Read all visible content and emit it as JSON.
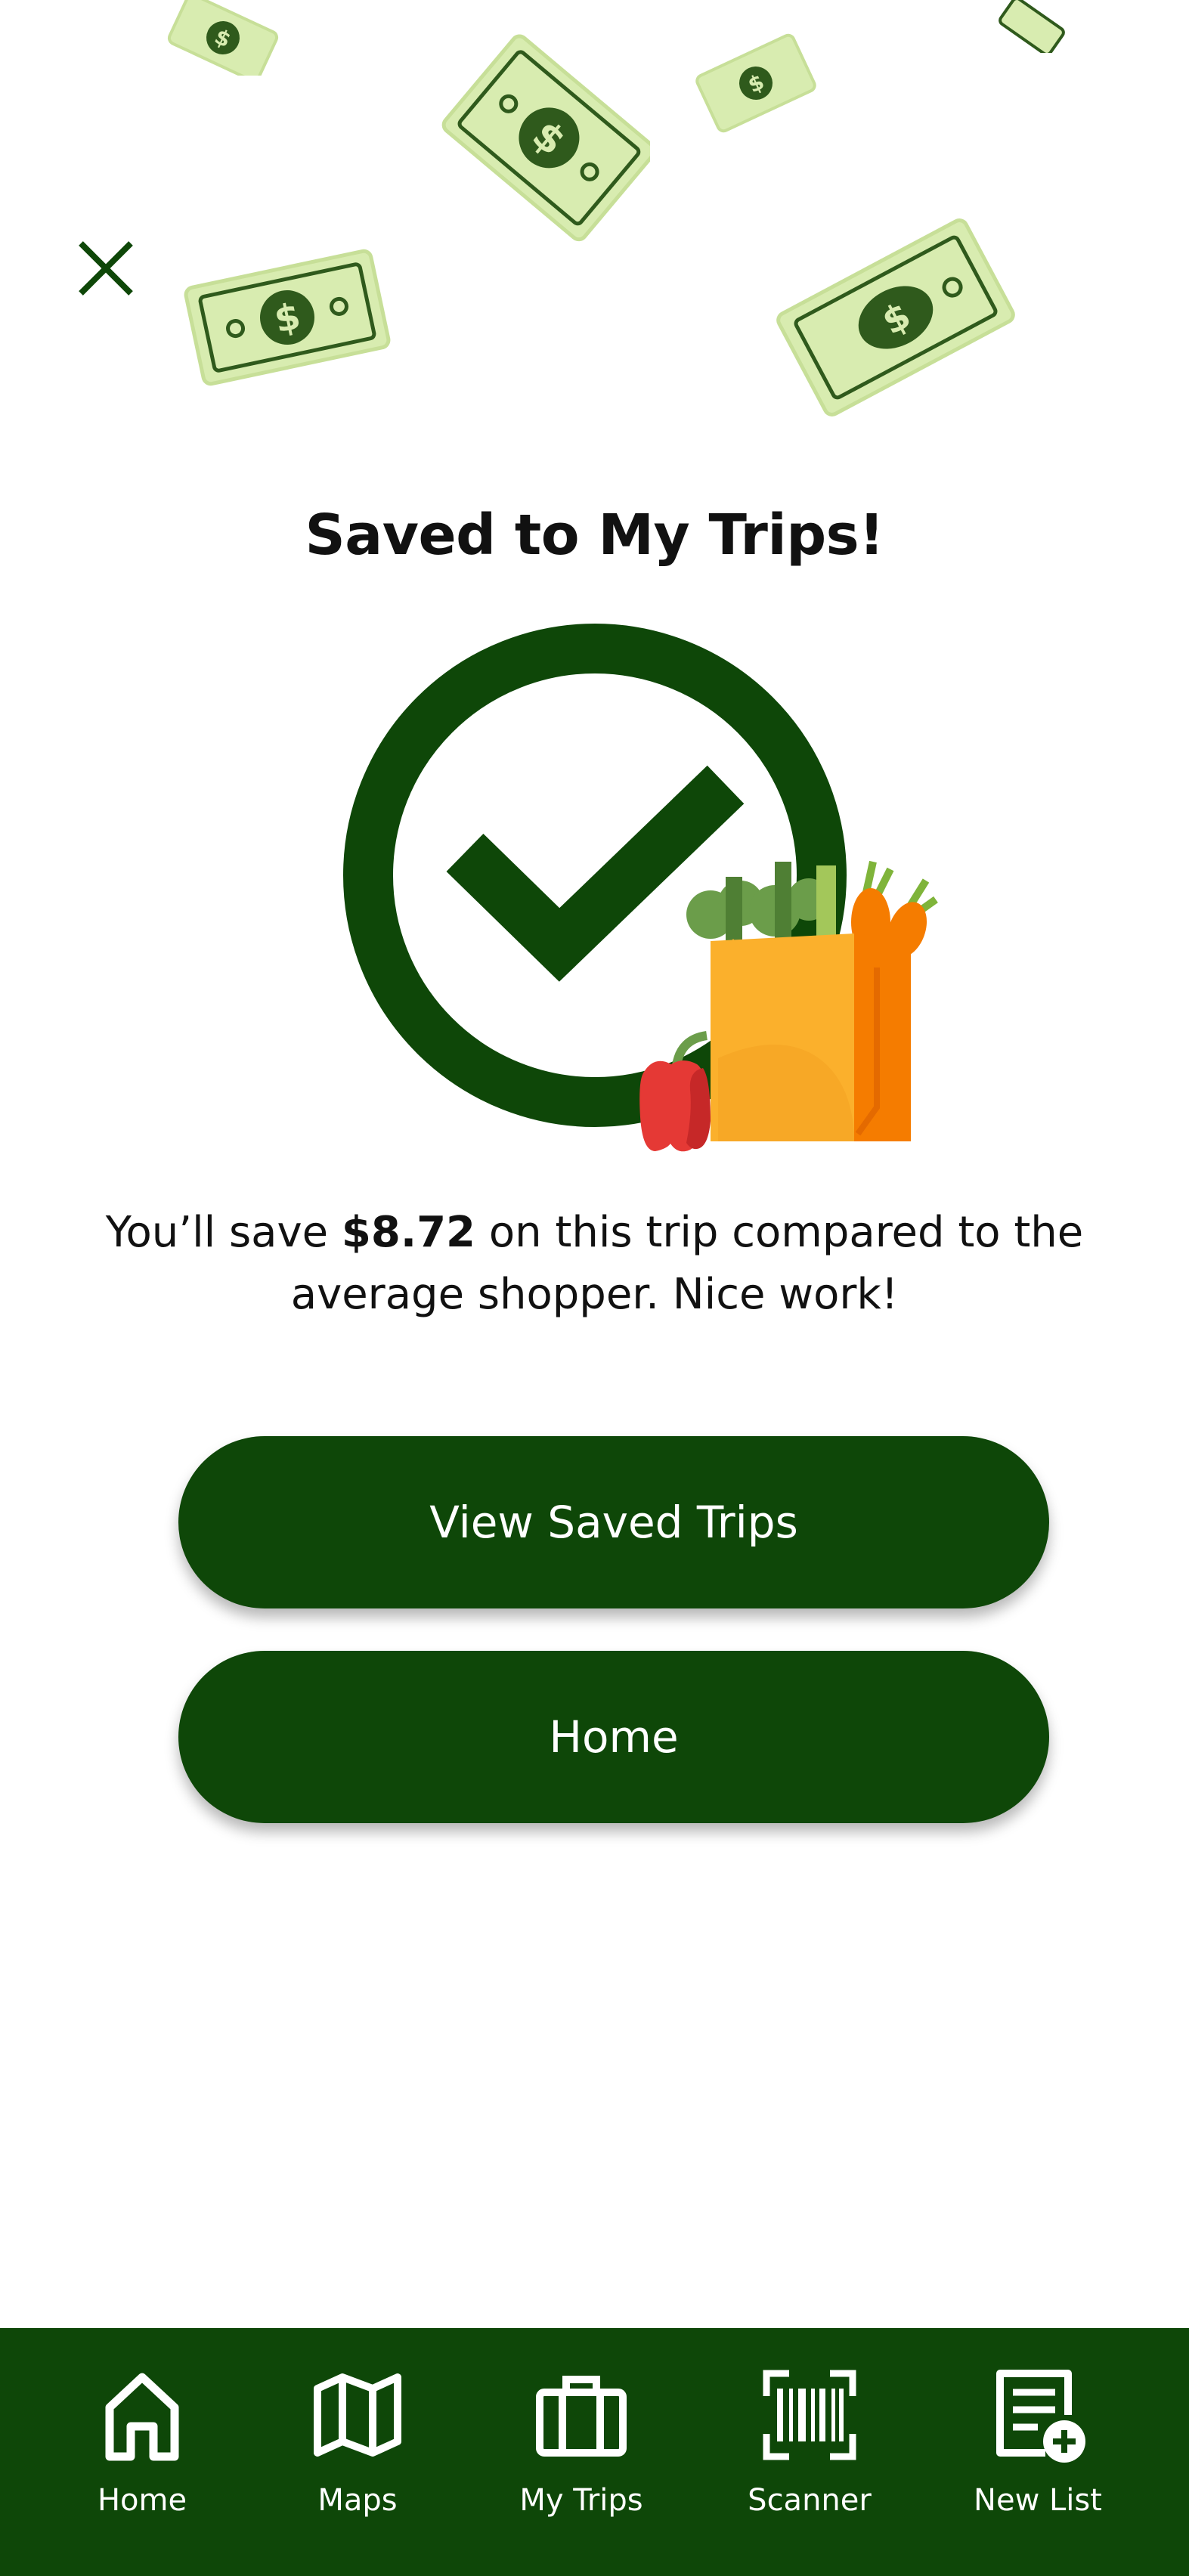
{
  "screen": {
    "title": "Saved to My Trips!",
    "savings_prefix": "You’ll save ",
    "savings_amount": "$8.72",
    "savings_suffix": " on this trip compared to the average shopper. Nice work!"
  },
  "actions": {
    "view_saved_trips": "View Saved Trips",
    "home": "Home"
  },
  "nav": {
    "items": [
      {
        "label": "Home",
        "icon": "home-icon"
      },
      {
        "label": "Maps",
        "icon": "map-icon"
      },
      {
        "label": "My Trips",
        "icon": "briefcase-icon"
      },
      {
        "label": "Scanner",
        "icon": "barcode-icon"
      },
      {
        "label": "New List",
        "icon": "new-list-icon"
      }
    ]
  },
  "colors": {
    "brand_green": "#0e4708",
    "bill_green": "#d8ecb0",
    "bag_yellow": "#fbb02c",
    "bag_orange": "#f57c00"
  }
}
